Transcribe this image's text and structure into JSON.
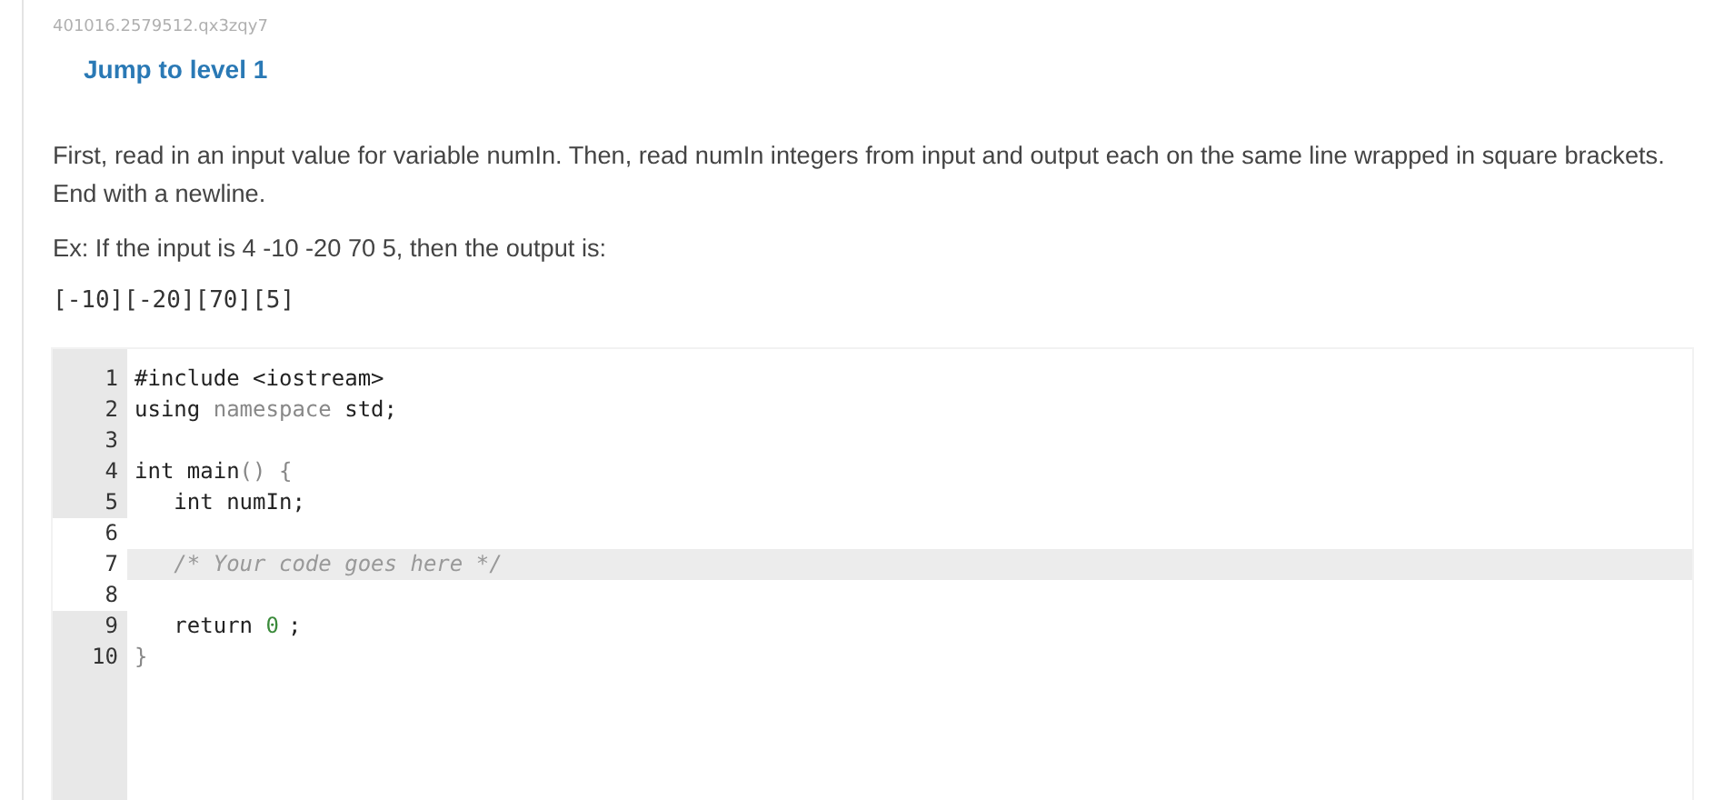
{
  "id_text": "401016.2579512.qx3zqy7",
  "level_link": "Jump to level 1",
  "paragraphs": [
    "First, read in an input value for variable numIn. Then, read numIn integers from input and output each on the same line wrapped in square brackets. End with a newline.",
    "Ex: If the input is 4 -10 -20 70 5, then the output is:"
  ],
  "output_example": "[-10][-20][70][5]",
  "code_lines": [
    {
      "number": "1",
      "editable": false,
      "active": false,
      "segments": [
        {
          "text": "#include <iostream>",
          "kind": "plain"
        }
      ]
    },
    {
      "number": "2",
      "editable": false,
      "active": false,
      "segments": [
        {
          "text": "using ",
          "kind": "plain"
        },
        {
          "text": "namespace ",
          "kind": "dim"
        },
        {
          "text": "std;",
          "kind": "plain"
        }
      ]
    },
    {
      "number": "3",
      "editable": false,
      "active": false
    },
    {
      "number": "4",
      "editable": false,
      "active": false,
      "segments": [
        {
          "text": "int main",
          "kind": "plain"
        },
        {
          "text": "() {",
          "kind": "dim"
        }
      ]
    },
    {
      "number": "5",
      "editable": false,
      "active": false,
      "segments": [
        {
          "text": "   int numIn;",
          "kind": "plain"
        }
      ]
    },
    {
      "number": "6",
      "editable": true,
      "active": false
    },
    {
      "number": "7",
      "editable": true,
      "active": true,
      "segments": [
        {
          "text": "   /* Your code goes here */",
          "kind": "comment"
        }
      ]
    },
    {
      "number": "8",
      "editable": true,
      "active": false
    },
    {
      "number": "9",
      "editable": false,
      "active": false,
      "segments": [
        {
          "text": "   return ",
          "kind": "plain"
        },
        {
          "text": "0",
          "kind": "number"
        },
        {
          "text": ";",
          "kind": "plain"
        }
      ]
    },
    {
      "number": "10",
      "editable": false,
      "active": false,
      "segments": [
        {
          "text": "}",
          "kind": "dim"
        }
      ]
    }
  ]
}
